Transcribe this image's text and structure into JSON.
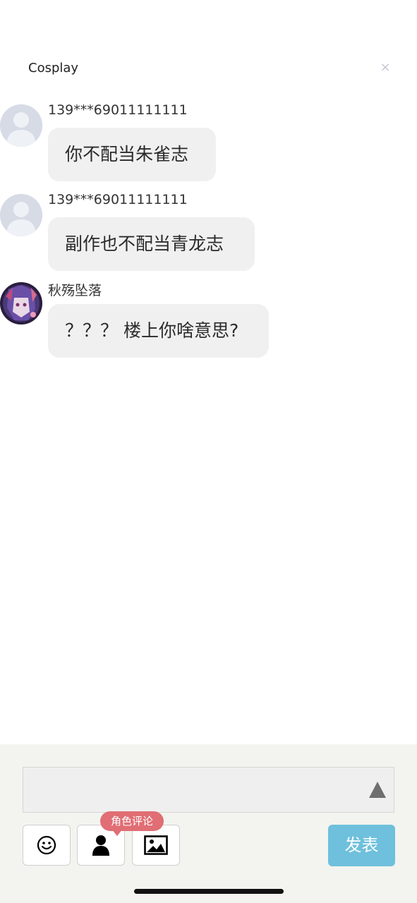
{
  "header": {
    "title": "Cosplay",
    "close_label": "×"
  },
  "messages": [
    {
      "username": "139***69011111111",
      "text": "你不配当朱雀志",
      "avatar": "default-avatar"
    },
    {
      "username": "139***69011111111",
      "text": "副作也不配当青龙志",
      "avatar": "default-avatar"
    },
    {
      "username": "秋殇坠落",
      "text": "？？？ 楼上你啥意思?",
      "avatar": "anime-avatar"
    }
  ],
  "composer": {
    "placeholder": "",
    "tooltip": "角色评论",
    "publish_label": "发表",
    "tools": [
      "smiley-icon",
      "person-icon",
      "image-icon"
    ]
  },
  "colors": {
    "bubble": "#f0f0f0",
    "panel": "#f3f4ef",
    "publish": "#6ec0dc",
    "tooltip": "#e06e74"
  }
}
